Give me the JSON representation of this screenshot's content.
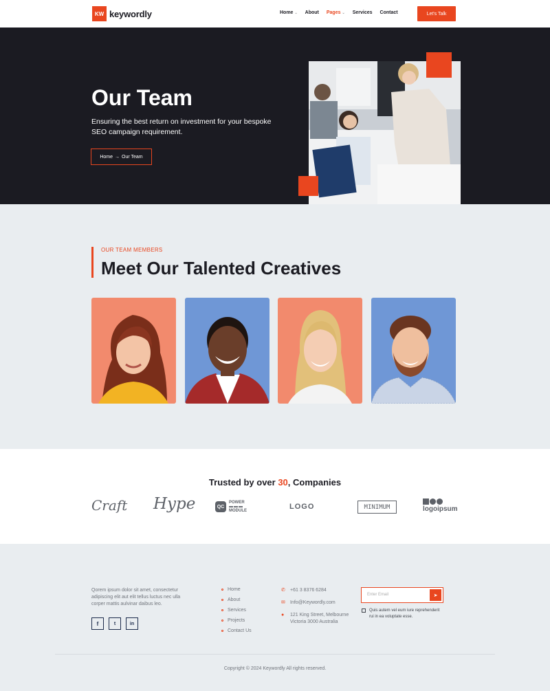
{
  "header": {
    "logo_mark": "KW",
    "logo_text": "keywordly",
    "nav": [
      {
        "label": "Home",
        "dropdown": true
      },
      {
        "label": "About",
        "dropdown": false
      },
      {
        "label": "Pages",
        "dropdown": true,
        "active": true
      },
      {
        "label": "Services",
        "dropdown": false
      },
      {
        "label": "Contact",
        "dropdown": false
      }
    ],
    "cta": "Let's Talk"
  },
  "hero": {
    "title": "Our Team",
    "subtitle": "Ensuring the best return on investment for your bespoke SEO campaign requirement.",
    "breadcrumb": {
      "home": "Home",
      "separator": "→",
      "current": "Our Team"
    }
  },
  "team": {
    "eyebrow": "OUR TEAM MEMBERS",
    "title": "Meet Our Talented Creatives",
    "members": [
      {
        "bg": "#f28a6d"
      },
      {
        "bg": "#6f97d6"
      },
      {
        "bg": "#f28a6d"
      },
      {
        "bg": "#6f97d6"
      }
    ]
  },
  "trusted": {
    "prefix": "Trusted by over ",
    "count": "30",
    "suffix": ", Companies",
    "brands": [
      "Craft",
      "Hype",
      "POWER",
      "MODULE",
      "LOGO",
      "MINIMUM",
      "logoipsum"
    ]
  },
  "footer": {
    "about": "Qorem ipsum dolor sit amet, consectetur adipiscing elit aut elit tellus luctus nec ulla corper mattis aulvinar daibus leo.",
    "social": [
      "f",
      "t",
      "in"
    ],
    "links": [
      "Home",
      "About",
      "Services",
      "Projects",
      "Contact Us"
    ],
    "phone": "+61 3 8376 6284",
    "email": "Info@Keywordly.com",
    "address": "121 King Street, Melbourne Victoria 3000 Australia",
    "email_placeholder": "Enter Email",
    "consent": "Quis autem vel eum iure reprehenderit rui in ea voluptate esse.",
    "copyright": "Copyright © 2024 Keywordly All rights reserved."
  },
  "colors": {
    "accent": "#e9461f",
    "dark": "#1b1b22",
    "light_bg": "#e9edf0"
  },
  "icons": [
    "chevron-down-icon",
    "arrow-right-icon",
    "phone-icon",
    "mail-icon",
    "location-pin-icon",
    "send-icon",
    "facebook-icon",
    "twitter-icon",
    "linkedin-icon"
  ]
}
